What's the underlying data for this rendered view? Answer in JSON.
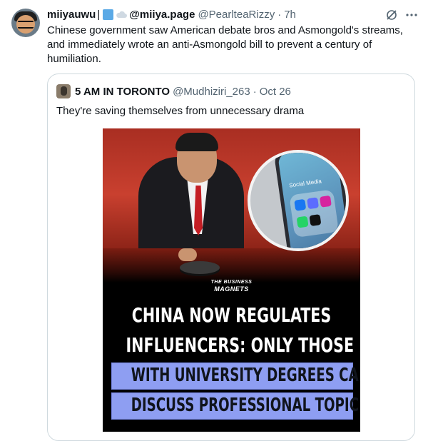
{
  "tweet": {
    "author": {
      "display_name": "miiyauwu",
      "separator": "|",
      "secondary_name": "@miiya.page",
      "handle": "@PearlteaRizzy",
      "dot": "·",
      "time": "7h"
    },
    "text": "Chinese government saw American debate bros and Asmongold's streams, and immediately wrote an anti-Asmongold bill to prevent a century of humiliation."
  },
  "quote": {
    "author": {
      "display_name": "5 AM IN TORONTO",
      "handle": "@Mudhiziri_263",
      "dot": "·",
      "date": "Oct 26"
    },
    "text": "They're saving themselves from unnecessary drama",
    "media": {
      "inset_label": "Social Media",
      "brand_line1": "THE BUSINESS",
      "brand_line2": "MAGNETS",
      "headline_line1": "CHINA NOW REGULATES",
      "headline_line2": "INFLUENCERS: ONLY THOSE",
      "highlight_line1": "WITH UNIVERSITY DEGREES CAN",
      "highlight_line2": "DISCUSS PROFESSIONAL TOPICS"
    }
  },
  "colors": {
    "text": "#0f1419",
    "secondary_text": "#536471",
    "border": "#cfd9de",
    "highlight": "#8e9ef2",
    "accent_red": "#c9402f"
  },
  "icons": [
    "grok-icon",
    "more-icon",
    "blue-square-icon",
    "cloud-icon"
  ]
}
